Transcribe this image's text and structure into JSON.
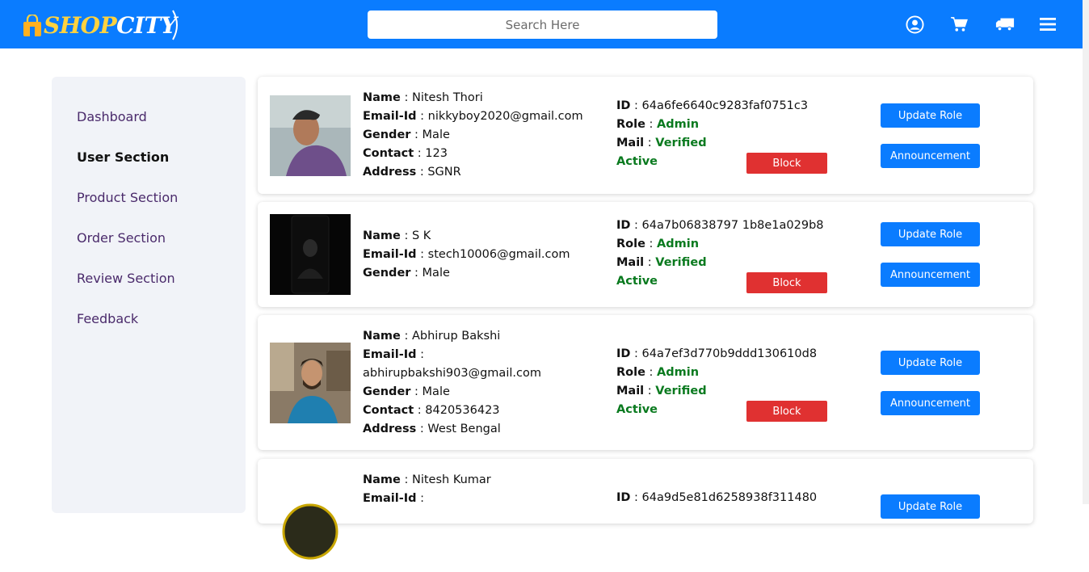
{
  "header": {
    "logo_part1": "SHOP",
    "logo_part2": "CITY",
    "search_placeholder": "Search Here",
    "icons": [
      "user-circle-icon",
      "cart-icon",
      "truck-icon",
      "menu-icon"
    ],
    "color": "#0a7cff"
  },
  "sidebar": {
    "items": [
      {
        "label": "Dashboard"
      },
      {
        "label": "User Section"
      },
      {
        "label": "Product Section"
      },
      {
        "label": "Order Section"
      },
      {
        "label": "Review Section"
      },
      {
        "label": "Feedback"
      }
    ],
    "active": "User Section"
  },
  "labels": {
    "name": "Name",
    "email": "Email-Id",
    "gender": "Gender",
    "contact": "Contact",
    "address": "Address",
    "id": "ID",
    "role": "Role",
    "mail": "Mail",
    "sep": " : ",
    "block": "Block",
    "update_role": "Update Role",
    "announcement": "Announcement"
  },
  "users": [
    {
      "name": "Nitesh Thori",
      "email": "nikkyboy2020@gmail.com",
      "gender": "Male",
      "contact": "123",
      "address": "SGNR",
      "id": "64a6fe6640c9283faf0751c3",
      "role": "Admin",
      "mail": "Verified",
      "status": "Active"
    },
    {
      "name": "S K",
      "email": "stech10006@gmail.com",
      "gender": "Male",
      "id": "64a7b06838797 1b8e1a029b8",
      "role": "Admin",
      "mail": "Verified",
      "status": "Active"
    },
    {
      "name": "Abhirup Bakshi",
      "email": "abhirupbakshi903@gmail.com",
      "gender": "Male",
      "contact": "8420536423",
      "address": "West Bengal",
      "id": "64a7ef3d770b9ddd130610d8",
      "role": "Admin",
      "mail": "Verified",
      "status": "Active"
    },
    {
      "name": "Nitesh Kumar",
      "id": "64a9d5e81d6258938f311480"
    }
  ],
  "colors": {
    "status_green": "#0a7a1f",
    "block_red": "#e03131",
    "logo_yellow": "#ffd23f"
  }
}
